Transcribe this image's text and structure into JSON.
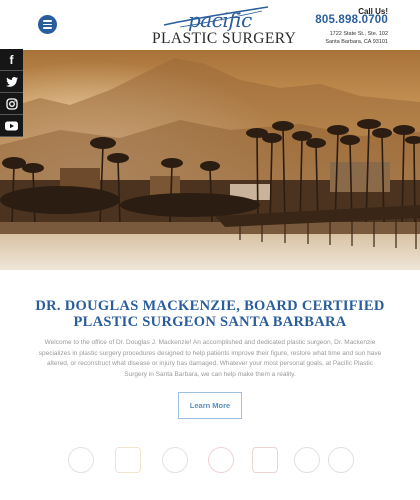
{
  "header": {
    "call_label": "Call Us!",
    "phone": "805.898.0700",
    "address_line1": "1722 State St., Ste. 102",
    "address_line2": "Santa Barbara, CA 93101",
    "logo_script": "pacific",
    "logo_main": "PLASTIC SURGERY",
    "menu_icon": "hamburger-menu-icon"
  },
  "social": {
    "facebook": "f",
    "icons": [
      "facebook-icon",
      "twitter-icon",
      "instagram-icon",
      "youtube-icon"
    ]
  },
  "main": {
    "headline_line1": "DR. DOUGLAS MACKENZIE, BOARD CERTIFIED",
    "headline_line2": "PLASTIC SURGEON SANTA BARBARA",
    "intro": "Welcome to the office of Dr. Douglas J. Mackenzie! An accomplished and dedicated plastic surgeon, Dr. Mackenzie specializes in plastic surgery procedures designed to help patients improve their figure, restore what time and sun have altered, or reconstruct what disease or injury has damaged. Whatever your most personal goals, at Pacific Plastic Surgery in Santa Barbara, we can help make them a reality.",
    "cta_label": "Learn More"
  },
  "colors": {
    "brand_blue": "#2a5d9c",
    "sky_top": "#b37b3f",
    "sky_glow": "#f3c98c",
    "water": "#e8dccb"
  }
}
